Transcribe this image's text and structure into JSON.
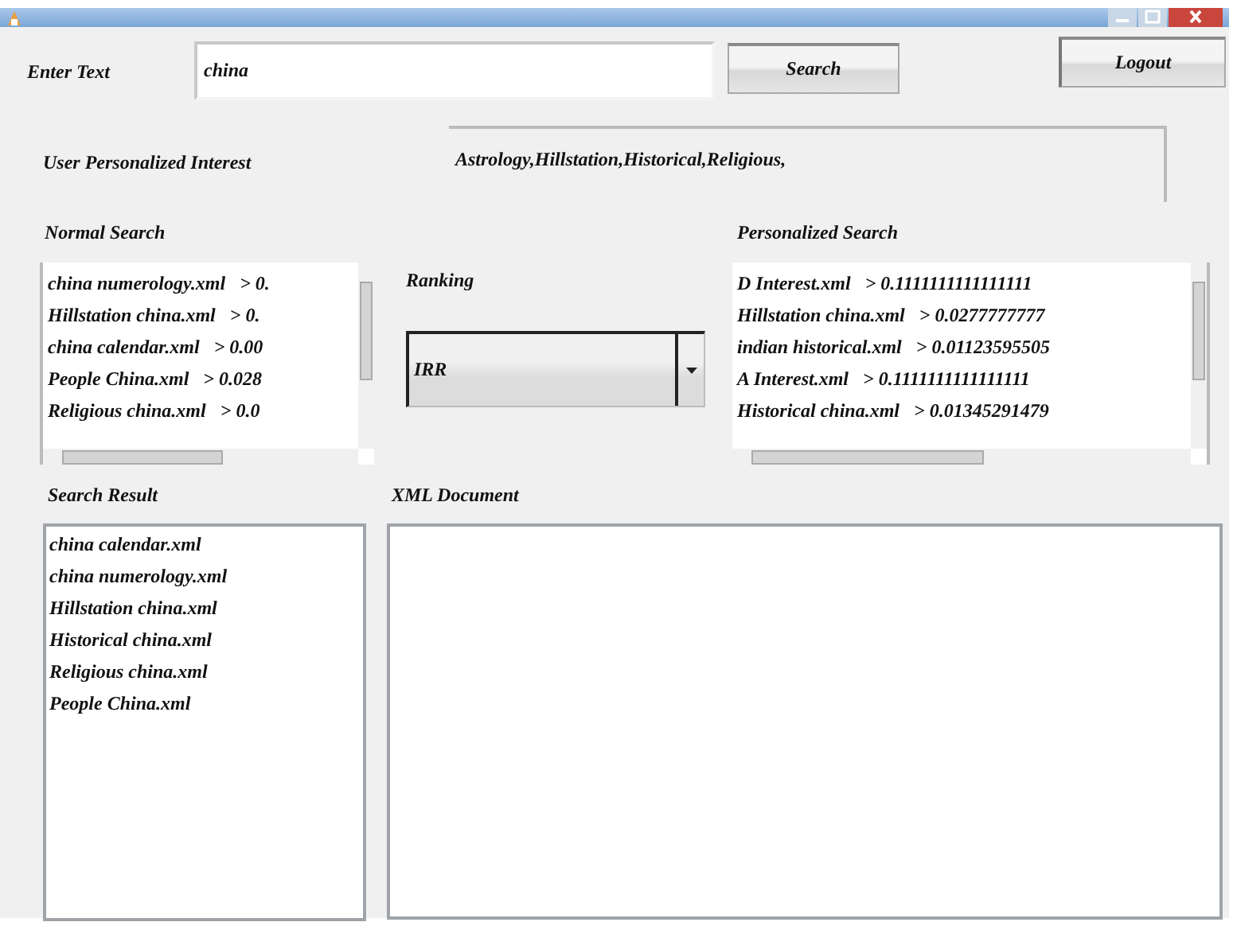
{
  "search": {
    "label": "Enter Text",
    "value": "china",
    "button": "Search"
  },
  "logout_button": "Logout",
  "interest": {
    "label": "User Personalized Interest",
    "value": "Astrology,Hillstation,Historical,Religious,"
  },
  "normal_search": {
    "label": "Normal Search",
    "items": [
      {
        "name": "china numerology.xml",
        "score": "> 0."
      },
      {
        "name": "Hillstation china.xml",
        "score": "> 0."
      },
      {
        "name": "china calendar.xml",
        "score": "> 0.00"
      },
      {
        "name": "People China.xml",
        "score": "> 0.028"
      },
      {
        "name": "Religious china.xml",
        "score": "> 0.0"
      }
    ]
  },
  "ranking": {
    "label": "Ranking",
    "value": "IRR"
  },
  "personalized_search": {
    "label": "Personalized Search",
    "items": [
      {
        "name": "D Interest.xml",
        "score": "> 0.1111111111111111"
      },
      {
        "name": "Hillstation china.xml",
        "score": "> 0.0277777777"
      },
      {
        "name": "indian historical.xml",
        "score": "> 0.01123595505"
      },
      {
        "name": "A Interest.xml",
        "score": "> 0.1111111111111111"
      },
      {
        "name": "Historical china.xml",
        "score": "> 0.01345291479"
      }
    ]
  },
  "search_result": {
    "label": "Search Result",
    "items": [
      "china calendar.xml",
      "china numerology.xml",
      "Hillstation china.xml",
      "Historical china.xml",
      "Religious china.xml",
      "People China.xml"
    ]
  },
  "xml_document": {
    "label": "XML Document"
  }
}
